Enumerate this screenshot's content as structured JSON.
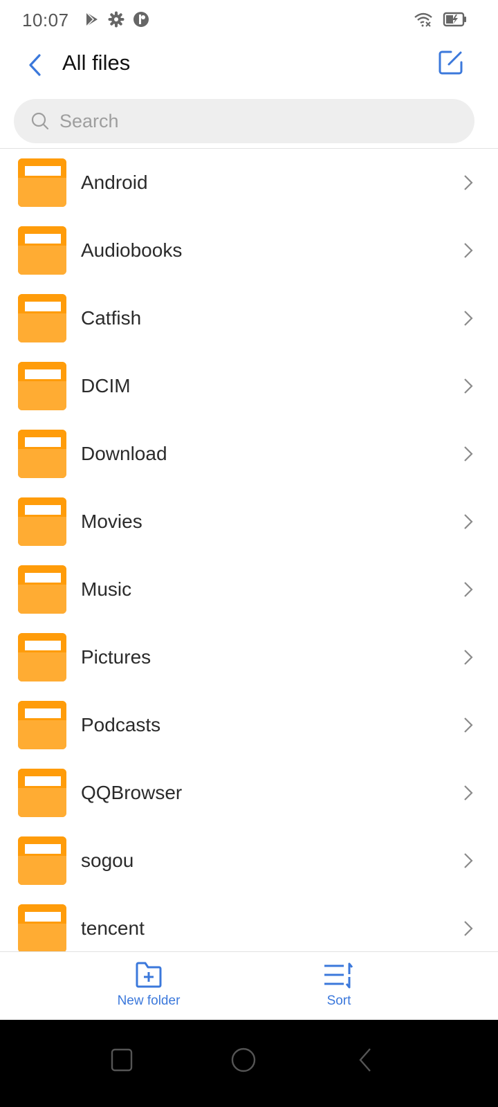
{
  "status_bar": {
    "time": "10:07",
    "left_icons": [
      "play-store-icon",
      "settings-gear-icon",
      "app-notification-icon"
    ],
    "right_icons": [
      "wifi-no-internet-icon",
      "battery-charging-icon"
    ]
  },
  "header": {
    "title": "All files",
    "back_icon": "chevron-left-icon",
    "edit_icon": "edit-icon"
  },
  "search": {
    "placeholder": "Search",
    "value": ""
  },
  "files": [
    {
      "name": "Android",
      "type": "folder"
    },
    {
      "name": "Audiobooks",
      "type": "folder"
    },
    {
      "name": "Catfish",
      "type": "folder"
    },
    {
      "name": "DCIM",
      "type": "folder"
    },
    {
      "name": "Download",
      "type": "folder"
    },
    {
      "name": "Movies",
      "type": "folder"
    },
    {
      "name": "Music",
      "type": "folder"
    },
    {
      "name": "Pictures",
      "type": "folder"
    },
    {
      "name": "Podcasts",
      "type": "folder"
    },
    {
      "name": "QQBrowser",
      "type": "folder"
    },
    {
      "name": "sogou",
      "type": "folder"
    },
    {
      "name": "tencent",
      "type": "folder"
    }
  ],
  "toolbar": {
    "new_folder_label": "New folder",
    "sort_label": "Sort"
  },
  "nav_bar": {
    "buttons": [
      "recents",
      "home",
      "back"
    ]
  },
  "colors": {
    "accent": "#3b78db",
    "folder": "#ffab2e",
    "folder_tab": "#ff9c0a"
  }
}
